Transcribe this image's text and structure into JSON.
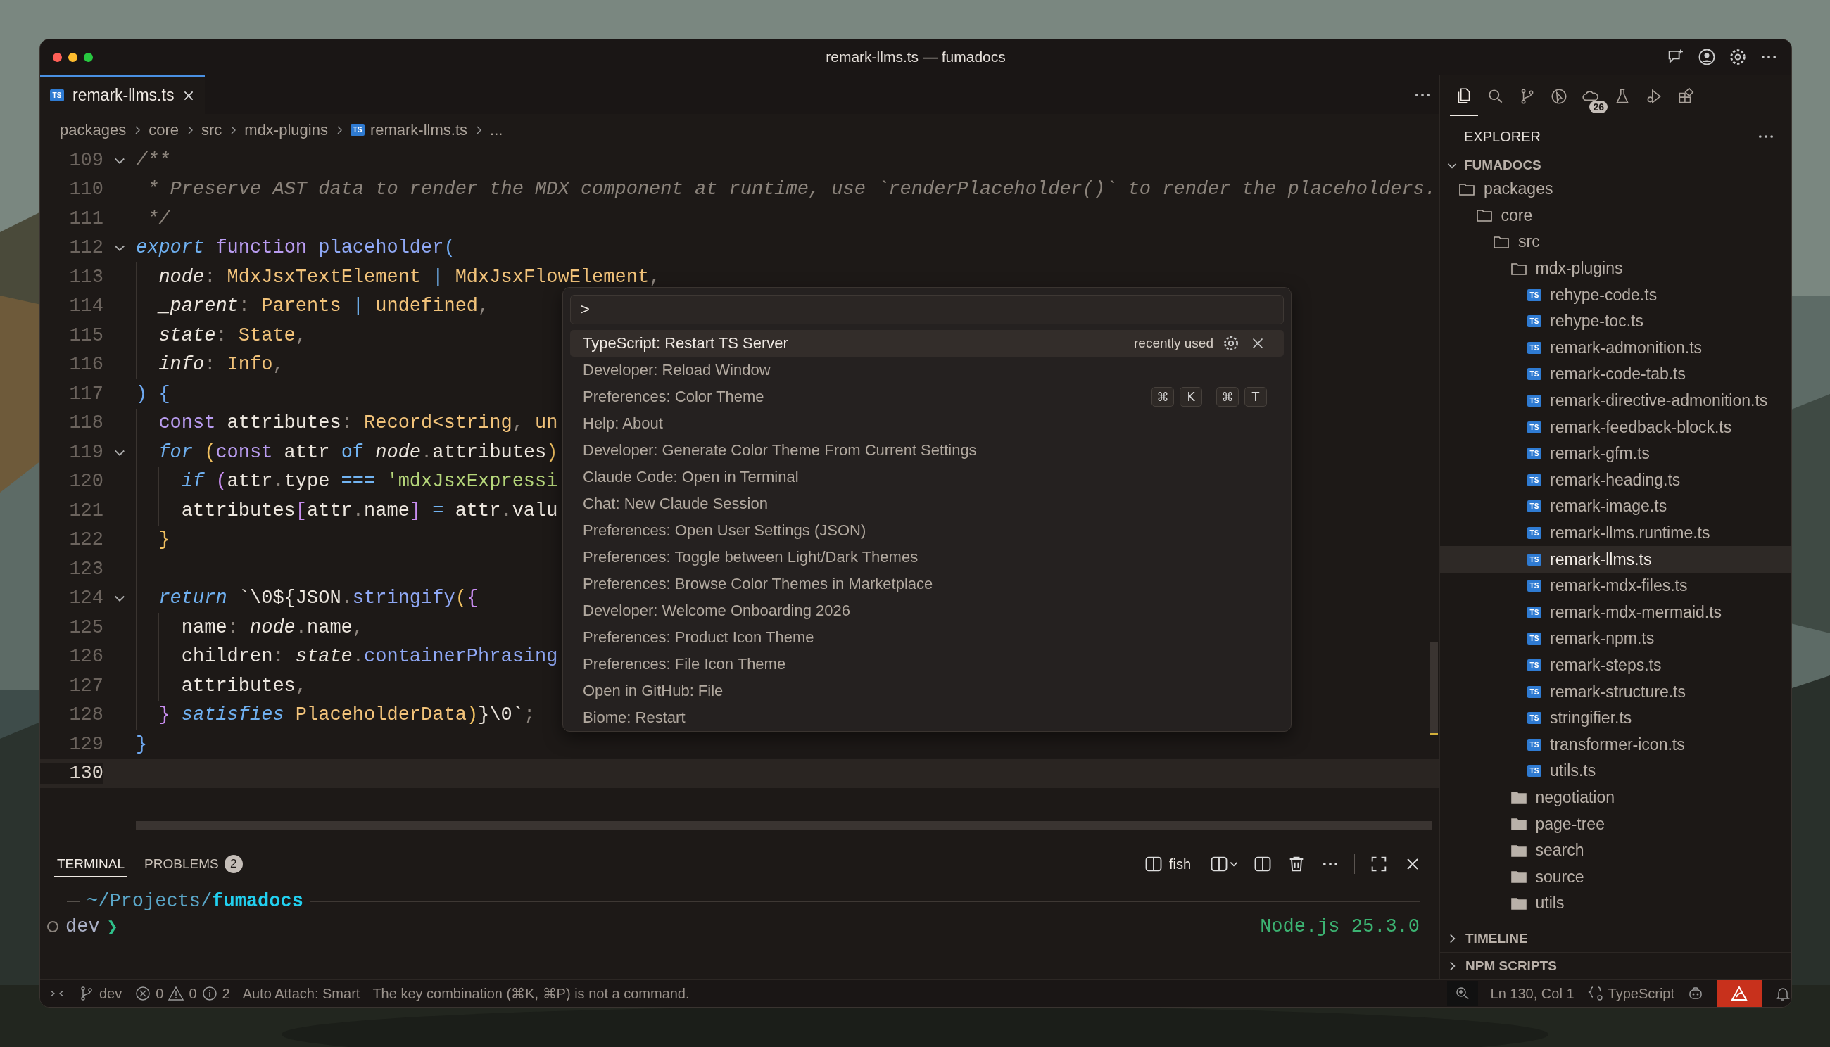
{
  "window": {
    "title": "remark-llms.ts — fumadocs"
  },
  "title_bar_actions": [
    {
      "kind": "chat"
    },
    {
      "kind": "account"
    },
    {
      "kind": "settings"
    },
    {
      "kind": "more"
    }
  ],
  "editor": {
    "tabs": [
      {
        "label": "remark-llms.ts",
        "badge": "TS",
        "selected": true
      }
    ],
    "breadcrumb": [
      {
        "label": "packages"
      },
      {
        "label": "core"
      },
      {
        "label": "src"
      },
      {
        "label": "mdx-plugins"
      },
      {
        "label": "remark-llms.ts",
        "badge": "TS"
      },
      {
        "label": "..."
      }
    ],
    "lines": [
      {
        "number": "109",
        "foldable": true,
        "current": false,
        "tokens": [
          {
            "text": "/**",
            "kind": "comment"
          }
        ]
      },
      {
        "number": "110",
        "foldable": false,
        "current": false,
        "tokens": [
          {
            "text": " * Preserve AST data to render the MDX component at runtime, use `renderPlaceholder()` to render the placeholders.",
            "kind": "comment"
          }
        ]
      },
      {
        "number": "111",
        "foldable": false,
        "current": false,
        "tokens": [
          {
            "text": " */",
            "kind": "comment"
          }
        ]
      },
      {
        "number": "112",
        "foldable": true,
        "current": false,
        "tokens": [
          {
            "text": "export",
            "kind": "control"
          },
          {
            "text": " function",
            "kind": "storage"
          },
          {
            "text": " placeholder",
            "kind": "function"
          },
          {
            "text": "(",
            "kind": "bracket1"
          }
        ],
        "children": [
          {
            "number": "113",
            "foldable": false,
            "current": false,
            "tokens": [
              {
                "text": "node",
                "kind": "param"
              },
              {
                "text": ":",
                "kind": "punct"
              },
              {
                "text": " MdxJsxTextElement",
                "kind": "type"
              },
              {
                "text": " |",
                "kind": "operator"
              },
              {
                "text": " MdxJsxFlowElement",
                "kind": "type"
              },
              {
                "text": ",",
                "kind": "punct"
              }
            ]
          },
          {
            "number": "114",
            "foldable": false,
            "current": false,
            "tokens": [
              {
                "text": "_parent",
                "kind": "param"
              },
              {
                "text": ":",
                "kind": "punct"
              },
              {
                "text": " Parents",
                "kind": "type"
              },
              {
                "text": " |",
                "kind": "operator"
              },
              {
                "text": " undefined",
                "kind": "type"
              },
              {
                "text": ",",
                "kind": "punct"
              }
            ]
          },
          {
            "number": "115",
            "foldable": false,
            "current": false,
            "tokens": [
              {
                "text": "state",
                "kind": "param"
              },
              {
                "text": ":",
                "kind": "punct"
              },
              {
                "text": " State",
                "kind": "type"
              },
              {
                "text": ",",
                "kind": "punct"
              }
            ]
          },
          {
            "number": "116",
            "foldable": false,
            "current": false,
            "tokens": [
              {
                "text": "info",
                "kind": "param"
              },
              {
                "text": ":",
                "kind": "punct"
              },
              {
                "text": " Info",
                "kind": "type"
              },
              {
                "text": ",",
                "kind": "punct"
              }
            ]
          }
        ]
      },
      {
        "number": "117",
        "foldable": false,
        "current": false,
        "tokens": [
          {
            "text": ")",
            "kind": "bracket1"
          },
          {
            "text": " {",
            "kind": "bracket1"
          }
        ],
        "children": [
          {
            "number": "118",
            "foldable": false,
            "current": false,
            "tokens": [
              {
                "text": "const",
                "kind": "storage"
              },
              {
                "text": " attributes",
                "kind": "plain"
              },
              {
                "text": ":",
                "kind": "punct"
              },
              {
                "text": " Record<string",
                "kind": "type"
              },
              {
                "text": ",",
                "kind": "punct"
              },
              {
                "text": " un",
                "kind": "type"
              }
            ]
          },
          {
            "number": "119",
            "foldable": true,
            "current": false,
            "tokens": [
              {
                "text": "for",
                "kind": "control"
              },
              {
                "text": " (",
                "kind": "bracket2"
              },
              {
                "text": "const",
                "kind": "storage"
              },
              {
                "text": " attr",
                "kind": "plain"
              },
              {
                "text": " of",
                "kind": "operator"
              },
              {
                "text": " node",
                "kind": "param"
              },
              {
                "text": ".",
                "kind": "punct"
              },
              {
                "text": "attributes",
                "kind": "plain"
              },
              {
                "text": ")",
                "kind": "bracket2"
              }
            ],
            "children": [
              {
                "number": "120",
                "foldable": false,
                "current": false,
                "tokens": [
                  {
                    "text": "if",
                    "kind": "control"
                  },
                  {
                    "text": " (",
                    "kind": "bracket3"
                  },
                  {
                    "text": "attr",
                    "kind": "plain"
                  },
                  {
                    "text": ".",
                    "kind": "punct"
                  },
                  {
                    "text": "type",
                    "kind": "plain"
                  },
                  {
                    "text": " ===",
                    "kind": "operator"
                  },
                  {
                    "text": " 'mdxJsxExpressi",
                    "kind": "string"
                  }
                ]
              },
              {
                "number": "121",
                "foldable": false,
                "current": false,
                "tokens": [
                  {
                    "text": "attributes",
                    "kind": "plain"
                  },
                  {
                    "text": "[",
                    "kind": "bracket3"
                  },
                  {
                    "text": "attr",
                    "kind": "plain"
                  },
                  {
                    "text": ".",
                    "kind": "punct"
                  },
                  {
                    "text": "name",
                    "kind": "plain"
                  },
                  {
                    "text": "]",
                    "kind": "bracket3"
                  },
                  {
                    "text": " =",
                    "kind": "operator"
                  },
                  {
                    "text": " attr",
                    "kind": "plain"
                  },
                  {
                    "text": ".",
                    "kind": "punct"
                  },
                  {
                    "text": "valu",
                    "kind": "plain"
                  }
                ]
              }
            ]
          },
          {
            "number": "122",
            "foldable": false,
            "current": false,
            "tokens": [
              {
                "text": "}",
                "kind": "bracket2"
              }
            ]
          },
          {
            "number": "123",
            "foldable": false,
            "current": false
          },
          {
            "number": "124",
            "foldable": true,
            "current": false,
            "tokens": [
              {
                "text": "return",
                "kind": "control"
              },
              {
                "text": " `\\0${JSON",
                "kind": "plain"
              },
              {
                "text": ".",
                "kind": "punct"
              },
              {
                "text": "stringify",
                "kind": "function"
              },
              {
                "text": "(",
                "kind": "bracket2"
              },
              {
                "text": "{",
                "kind": "bracket3"
              }
            ],
            "children": [
              {
                "number": "125",
                "foldable": false,
                "current": false,
                "tokens": [
                  {
                    "text": "name",
                    "kind": "plain"
                  },
                  {
                    "text": ":",
                    "kind": "punct"
                  },
                  {
                    "text": " node",
                    "kind": "param"
                  },
                  {
                    "text": ".",
                    "kind": "punct"
                  },
                  {
                    "text": "name",
                    "kind": "plain"
                  },
                  {
                    "text": ",",
                    "kind": "punct"
                  }
                ]
              },
              {
                "number": "126",
                "foldable": false,
                "current": false,
                "tokens": [
                  {
                    "text": "children",
                    "kind": "plain"
                  },
                  {
                    "text": ":",
                    "kind": "punct"
                  },
                  {
                    "text": " state",
                    "kind": "param"
                  },
                  {
                    "text": ".",
                    "kind": "punct"
                  },
                  {
                    "text": "containerPhrasing",
                    "kind": "function"
                  }
                ]
              },
              {
                "number": "127",
                "foldable": false,
                "current": false,
                "tokens": [
                  {
                    "text": "attributes",
                    "kind": "plain"
                  },
                  {
                    "text": ",",
                    "kind": "punct"
                  }
                ]
              }
            ]
          },
          {
            "number": "128",
            "foldable": false,
            "current": false,
            "tokens": [
              {
                "text": "}",
                "kind": "bracket3"
              },
              {
                "text": " satisfies",
                "kind": "control"
              },
              {
                "text": " PlaceholderData",
                "kind": "type"
              },
              {
                "text": ")",
                "kind": "bracket2"
              },
              {
                "text": "}\\0`",
                "kind": "plain"
              },
              {
                "text": ";",
                "kind": "punct"
              }
            ]
          }
        ]
      },
      {
        "number": "129",
        "foldable": false,
        "current": false,
        "tokens": [
          {
            "text": "}",
            "kind": "bracket1"
          }
        ]
      },
      {
        "number": "130",
        "foldable": false,
        "current": true
      }
    ]
  },
  "command_palette": {
    "value": ">",
    "items": [
      {
        "label": "TypeScript: Restart TS Server",
        "selected": true,
        "detail": "recently used"
      },
      {
        "label": "Developer: Reload Window",
        "selected": false
      },
      {
        "label": "Preferences: Color Theme",
        "selected": false,
        "keys": [
          [
            "⌘",
            "K"
          ],
          [
            "⌘",
            "T"
          ]
        ]
      },
      {
        "label": "Help: About",
        "selected": false
      },
      {
        "label": "Developer: Generate Color Theme From Current Settings",
        "selected": false
      },
      {
        "label": "Claude Code: Open in Terminal",
        "selected": false
      },
      {
        "label": "Chat: New Claude Session",
        "selected": false
      },
      {
        "label": "Preferences: Open User Settings (JSON)",
        "selected": false
      },
      {
        "label": "Preferences: Toggle between Light/Dark Themes",
        "selected": false
      },
      {
        "label": "Preferences: Browse Color Themes in Marketplace",
        "selected": false
      },
      {
        "label": "Developer: Welcome Onboarding 2026",
        "selected": false
      },
      {
        "label": "Preferences: Product Icon Theme",
        "selected": false
      },
      {
        "label": "Preferences: File Icon Theme",
        "selected": false
      },
      {
        "label": "Open in GitHub: File",
        "selected": false
      },
      {
        "label": "Biome: Restart",
        "selected": false
      }
    ]
  },
  "sidebar": {
    "activity": [
      {
        "kind": "files",
        "selected": true
      },
      {
        "kind": "search",
        "selected": false
      },
      {
        "kind": "branch",
        "selected": false
      },
      {
        "kind": "cursor-circle",
        "selected": false
      },
      {
        "kind": "cloud",
        "selected": false,
        "badge": "26"
      },
      {
        "kind": "flask",
        "selected": false
      },
      {
        "kind": "bug-play",
        "selected": false
      },
      {
        "kind": "blocks",
        "selected": false
      }
    ],
    "title": "EXPLORER",
    "root": {
      "label": "FUMADOCS",
      "expanded": true
    },
    "tree": [
      {
        "name": "packages",
        "kind": "folder",
        "expanded": true,
        "selected": false,
        "children": [
          {
            "name": "core",
            "kind": "folder",
            "expanded": true,
            "selected": false,
            "children": [
              {
                "name": "src",
                "kind": "folder",
                "expanded": true,
                "selected": false,
                "children": [
                  {
                    "name": "mdx-plugins",
                    "kind": "folder",
                    "expanded": true,
                    "selected": false,
                    "children": [
                      {
                        "name": "rehype-code.ts",
                        "kind": "file",
                        "badge": "TS",
                        "selected": false
                      },
                      {
                        "name": "rehype-toc.ts",
                        "kind": "file",
                        "badge": "TS",
                        "selected": false
                      },
                      {
                        "name": "remark-admonition.ts",
                        "kind": "file",
                        "badge": "TS",
                        "selected": false
                      },
                      {
                        "name": "remark-code-tab.ts",
                        "kind": "file",
                        "badge": "TS",
                        "selected": false
                      },
                      {
                        "name": "remark-directive-admonition.ts",
                        "kind": "file",
                        "badge": "TS",
                        "selected": false
                      },
                      {
                        "name": "remark-feedback-block.ts",
                        "kind": "file",
                        "badge": "TS",
                        "selected": false
                      },
                      {
                        "name": "remark-gfm.ts",
                        "kind": "file",
                        "badge": "TS",
                        "selected": false
                      },
                      {
                        "name": "remark-heading.ts",
                        "kind": "file",
                        "badge": "TS",
                        "selected": false
                      },
                      {
                        "name": "remark-image.ts",
                        "kind": "file",
                        "badge": "TS",
                        "selected": false
                      },
                      {
                        "name": "remark-llms.runtime.ts",
                        "kind": "file",
                        "badge": "TS",
                        "selected": false
                      },
                      {
                        "name": "remark-llms.ts",
                        "kind": "file",
                        "badge": "TS",
                        "selected": true
                      },
                      {
                        "name": "remark-mdx-files.ts",
                        "kind": "file",
                        "badge": "TS",
                        "selected": false
                      },
                      {
                        "name": "remark-mdx-mermaid.ts",
                        "kind": "file",
                        "badge": "TS",
                        "selected": false
                      },
                      {
                        "name": "remark-npm.ts",
                        "kind": "file",
                        "badge": "TS",
                        "selected": false
                      },
                      {
                        "name": "remark-steps.ts",
                        "kind": "file",
                        "badge": "TS",
                        "selected": false
                      },
                      {
                        "name": "remark-structure.ts",
                        "kind": "file",
                        "badge": "TS",
                        "selected": false
                      },
                      {
                        "name": "stringifier.ts",
                        "kind": "file",
                        "badge": "TS",
                        "selected": false
                      },
                      {
                        "name": "transformer-icon.ts",
                        "kind": "file",
                        "badge": "TS",
                        "selected": false
                      },
                      {
                        "name": "utils.ts",
                        "kind": "file",
                        "badge": "TS",
                        "selected": false
                      }
                    ]
                  },
                  {
                    "name": "negotiation",
                    "kind": "folder",
                    "expanded": false,
                    "selected": false
                  },
                  {
                    "name": "page-tree",
                    "kind": "folder",
                    "expanded": false,
                    "selected": false
                  },
                  {
                    "name": "search",
                    "kind": "folder",
                    "expanded": false,
                    "selected": false
                  },
                  {
                    "name": "source",
                    "kind": "folder",
                    "expanded": false,
                    "selected": false
                  },
                  {
                    "name": "utils",
                    "kind": "folder",
                    "expanded": false,
                    "selected": false
                  }
                ]
              }
            ]
          }
        ]
      }
    ],
    "sections": [
      {
        "title": "TIMELINE",
        "expanded": false
      },
      {
        "title": "NPM SCRIPTS",
        "expanded": false
      }
    ]
  },
  "panel": {
    "tabs": [
      {
        "label": "TERMINAL",
        "selected": true
      },
      {
        "label": "PROBLEMS",
        "selected": false,
        "count": "2"
      }
    ],
    "shell": "fish",
    "terminal": {
      "path": "~/Projects/**fumadocs**",
      "runtime": "Node.js 25.3.0",
      "branch": "dev",
      "prompt": "❯"
    }
  },
  "status_bar": {
    "branch": "dev",
    "errors": "0",
    "warnings": "0",
    "infos": "2",
    "auto_attach": "Auto Attach: Smart",
    "message": "The key combination (⌘K, ⌘P) is not a command.",
    "position": "Ln 130, Col 1",
    "language": "TypeScript"
  }
}
